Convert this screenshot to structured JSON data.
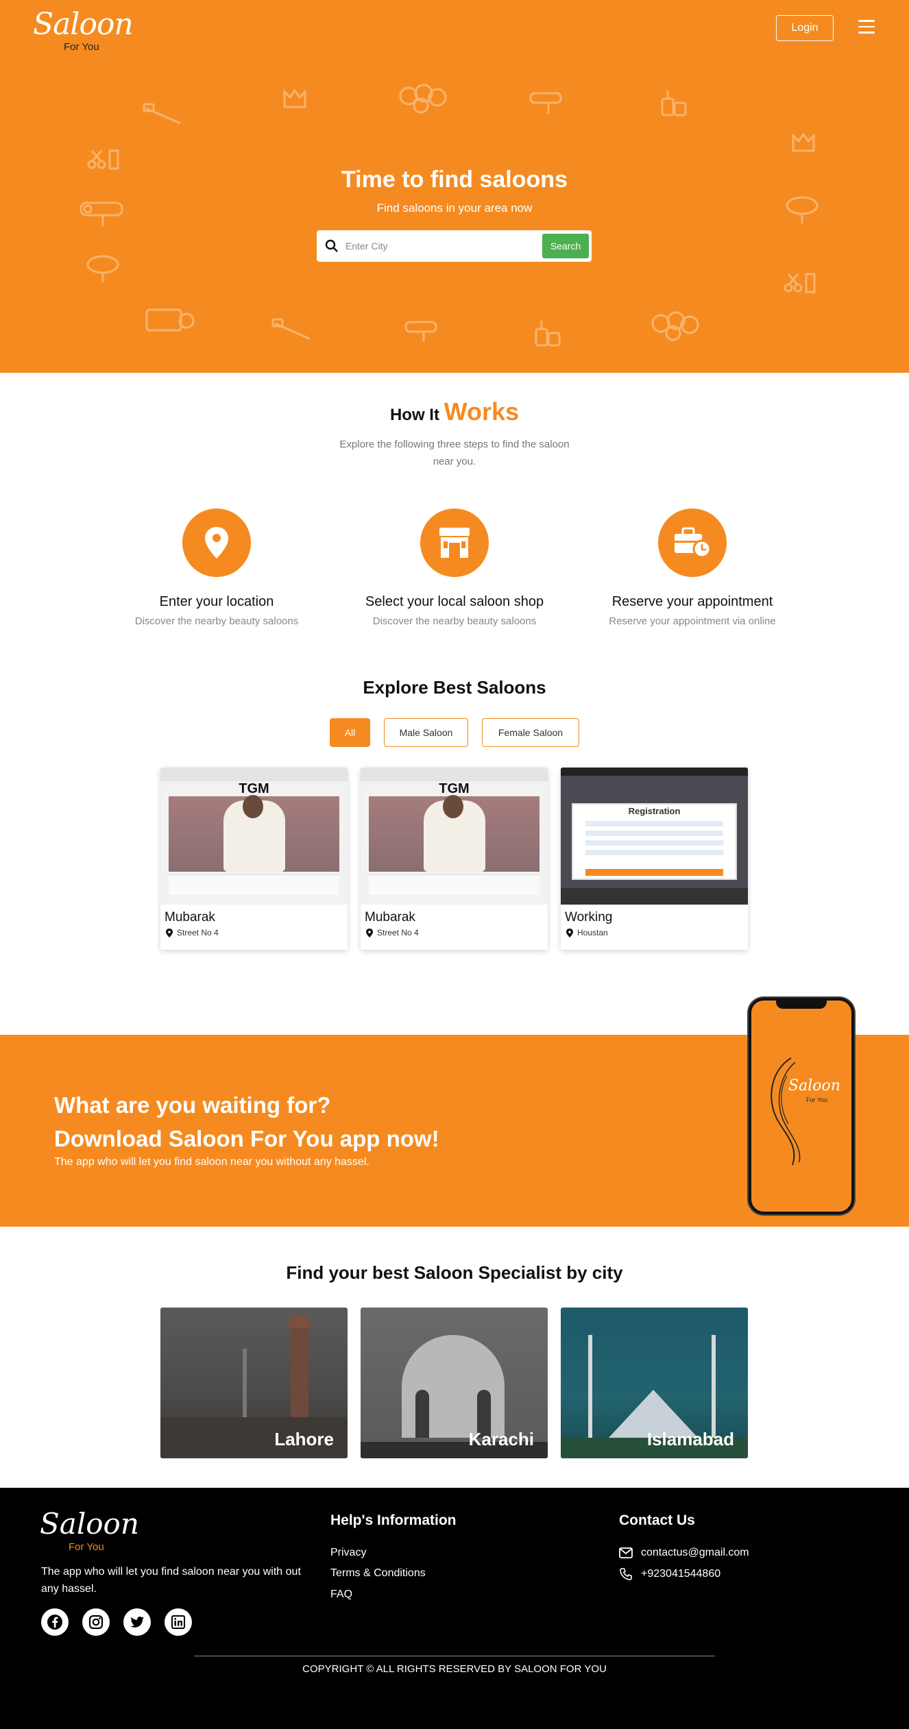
{
  "brand": {
    "logo_script": "Saloon",
    "logo_sub": "For You"
  },
  "header": {
    "login_label": "Login"
  },
  "hero": {
    "title": "Time to find saloons",
    "subtitle": "Find saloons in your area now",
    "search_placeholder": "Enter City",
    "search_button": "Search"
  },
  "how": {
    "title_plain": "How It",
    "title_accent": "Works",
    "description": "Explore the following three steps to find the saloon near you.",
    "steps": [
      {
        "icon": "location-pin-icon",
        "title": "Enter your location",
        "desc": "Discover the nearby beauty saloons"
      },
      {
        "icon": "shop-icon",
        "title": "Select your local saloon shop",
        "desc": "Discover the nearby beauty saloons"
      },
      {
        "icon": "briefcase-clock-icon",
        "title": "Reserve your appointment",
        "desc": "Reserve your appointment via online"
      }
    ]
  },
  "explore": {
    "title": "Explore Best Saloons",
    "filters": [
      "All",
      "Male Saloon",
      "Female Saloon"
    ],
    "active_filter": "All",
    "cards": [
      {
        "name": "Mubarak",
        "location": "Street No 4",
        "thumb_text": "TGM"
      },
      {
        "name": "Mubarak",
        "location": "Street No 4",
        "thumb_text": "TGM"
      },
      {
        "name": "Working",
        "location": "Houstan",
        "thumb_text": "Registration"
      }
    ]
  },
  "app_banner": {
    "line1": "What are you waiting for?",
    "line2": "Download Saloon For You app now!",
    "line3": "The app who will let you find saloon near you without any hassel."
  },
  "cities": {
    "title": "Find your best Saloon Specialist by city",
    "items": [
      "Lahore",
      "Karachi",
      "Islamabad"
    ]
  },
  "footer": {
    "description": "The app who will let you find saloon near you with out any hassel.",
    "socials": [
      "facebook-icon",
      "instagram-icon",
      "twitter-icon",
      "linkedin-icon"
    ],
    "help_title": "Help's Information",
    "help_links": [
      "Privacy",
      "Terms & Conditions",
      "FAQ"
    ],
    "contact_title": "Contact Us",
    "email": "contactus@gmail.com",
    "phone": "+923041544860",
    "copyright": "COPYRIGHT © ALL RIGHTS RESERVED BY SALOON FOR YOU"
  },
  "colors": {
    "accent": "#F58B20",
    "search_button": "#4CAF50",
    "footer_bg": "#000000"
  }
}
